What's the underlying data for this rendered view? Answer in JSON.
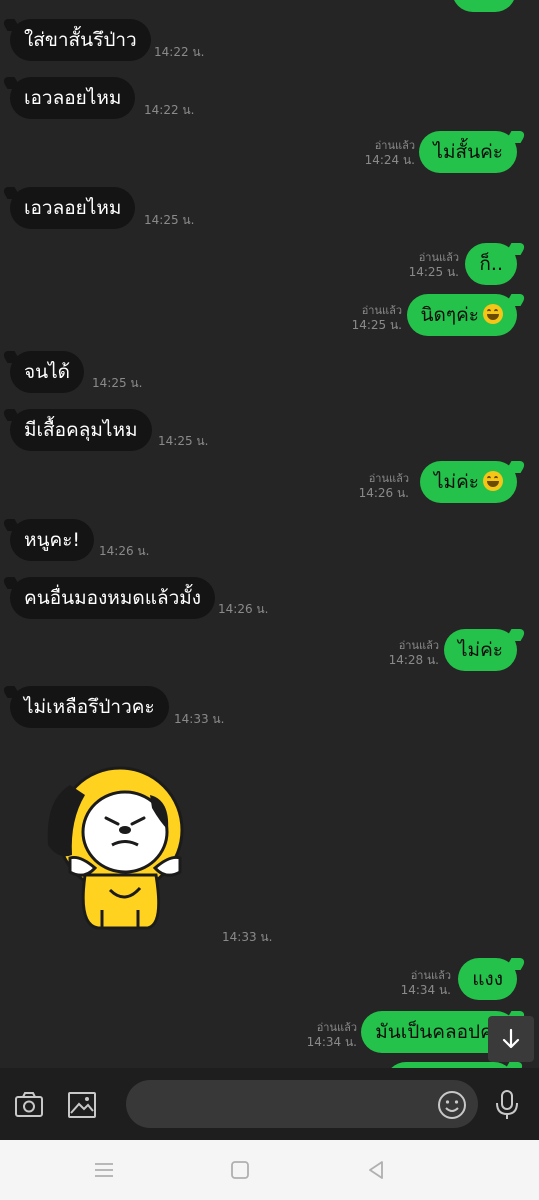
{
  "messages": [
    {
      "dir": "in",
      "text": "ใส่ขาสั้นรึป่าว",
      "time": "14:22 น."
    },
    {
      "dir": "in",
      "text": "เอวลอยไหม",
      "time": "14:22 น."
    },
    {
      "dir": "out",
      "text": "ไม่สั้นค่ะ",
      "read": "อ่านแล้ว",
      "time": "14:24 น."
    },
    {
      "dir": "in",
      "text": "เอวลอยไหม",
      "time": "14:25 น."
    },
    {
      "dir": "out",
      "text": "ก็..",
      "read": "อ่านแล้ว",
      "time": "14:25 น."
    },
    {
      "dir": "out",
      "text": "นิดๆค่ะ",
      "emoji": "grin-sweat-emoji",
      "read": "อ่านแล้ว",
      "time": "14:25 น."
    },
    {
      "dir": "in",
      "text": "จนได้",
      "time": "14:25 น."
    },
    {
      "dir": "in",
      "text": "มีเสื้อคลุมไหม",
      "time": "14:25 น."
    },
    {
      "dir": "out",
      "text": "ไม่ค่ะ",
      "emoji": "grin-sweat-emoji",
      "read": "อ่านแล้ว",
      "time": "14:26 น."
    },
    {
      "dir": "in",
      "text": "หนูคะ!",
      "time": "14:26 น."
    },
    {
      "dir": "in",
      "text": "คนอื่นมองหมดแล้วมั้ง",
      "time": "14:26 น."
    },
    {
      "dir": "out",
      "text": "ไม่ค่ะ",
      "read": "อ่านแล้ว",
      "time": "14:28 น."
    },
    {
      "dir": "in",
      "text": "ไม่เหลือรึป่าวคะ",
      "time": "14:33 น."
    },
    {
      "dir": "out",
      "text": "แงง",
      "read": "อ่านแล้ว",
      "time": "14:34 น."
    },
    {
      "dir": "out",
      "text": "มันเป็นคลอปค่ะ",
      "read": "อ่านแล้ว",
      "time": "14:34 น."
    }
  ],
  "sticker": {
    "icon": "yellow-hoodie-puppy-sticker",
    "time": "14:33 น."
  },
  "input": {
    "placeholder": ""
  },
  "icons": {
    "camera": "camera-icon",
    "image": "image-icon",
    "emoji": "emoji-icon",
    "mic": "microphone-icon",
    "scroll": "arrow-down-icon",
    "menu": "menu-icon",
    "home": "home-icon",
    "back": "back-icon"
  },
  "colors": {
    "background": "#252525",
    "incoming_bubble": "#141414",
    "outgoing_bubble": "#24c24a",
    "timestamp": "#8a8a8a"
  }
}
